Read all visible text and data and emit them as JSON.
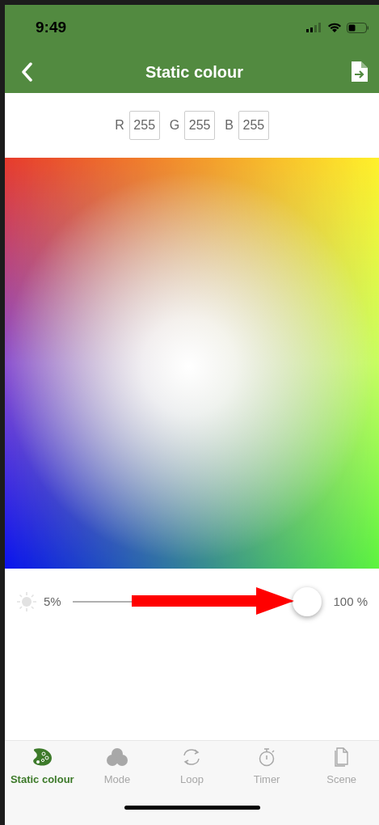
{
  "status_bar": {
    "time": "9:49"
  },
  "header": {
    "title": "Static colour"
  },
  "rgb": [
    {
      "label": "R",
      "value": "255"
    },
    {
      "label": "G",
      "value": "255"
    },
    {
      "label": "B",
      "value": "255"
    }
  ],
  "brightness": {
    "min_label": "5%",
    "max_label": "100 %",
    "level": 1
  },
  "tabs": [
    {
      "label": "Static colour",
      "kind": "palette",
      "selected": true
    },
    {
      "label": "Mode",
      "kind": "circles",
      "selected": false
    },
    {
      "label": "Loop",
      "kind": "loop",
      "selected": false
    },
    {
      "label": "Timer",
      "kind": "timer",
      "selected": false
    },
    {
      "label": "Scene",
      "kind": "scene",
      "selected": false
    }
  ]
}
